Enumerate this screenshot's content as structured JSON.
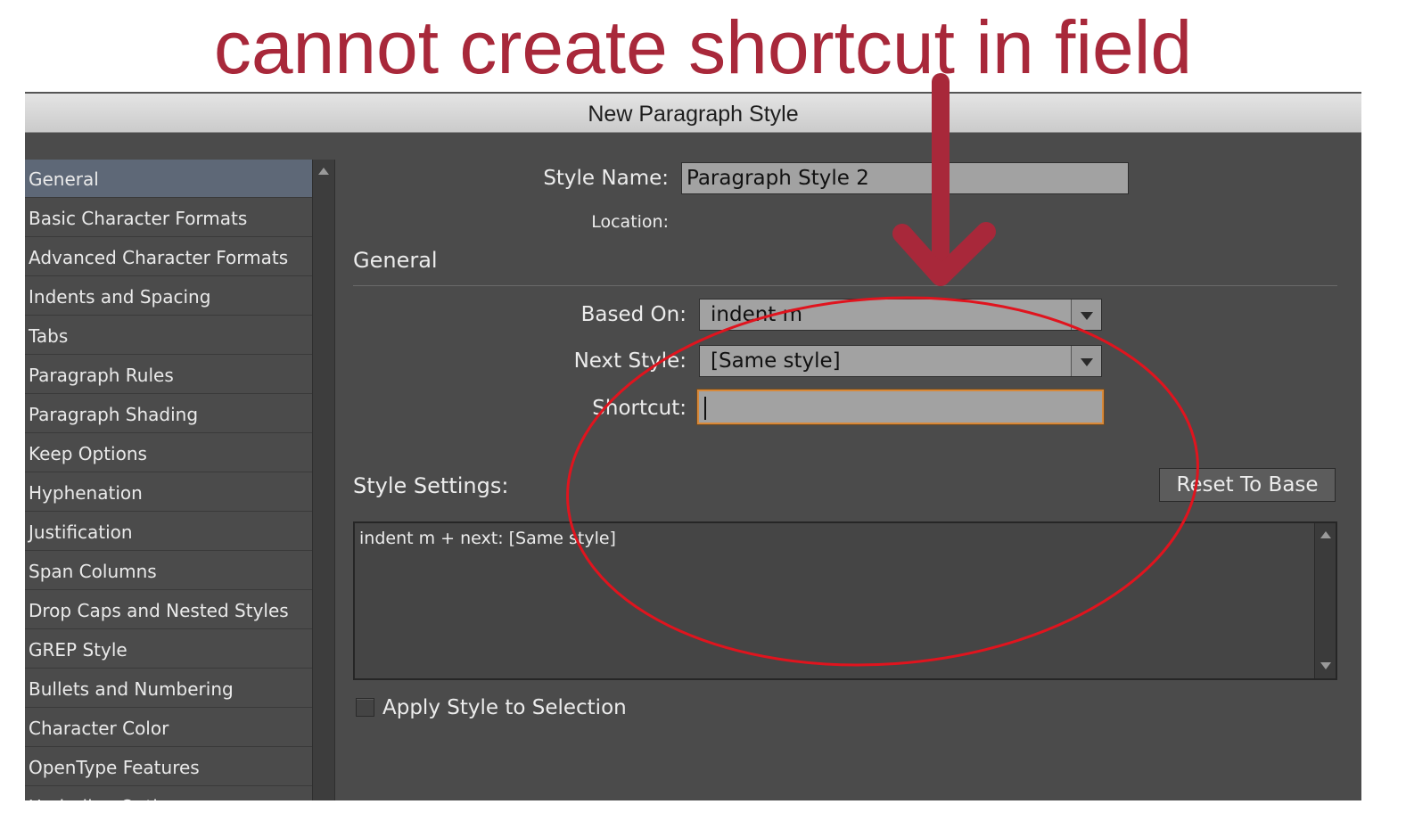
{
  "annotation": {
    "title": "cannot create shortcut in field",
    "color": "#a8283a",
    "circle_color": "#e0141e"
  },
  "window": {
    "title": "New Paragraph Style"
  },
  "sidebar": {
    "items": [
      {
        "label": "General",
        "selected": true
      },
      {
        "label": "Basic Character Formats"
      },
      {
        "label": "Advanced Character Formats"
      },
      {
        "label": "Indents and Spacing"
      },
      {
        "label": "Tabs"
      },
      {
        "label": "Paragraph Rules"
      },
      {
        "label": "Paragraph Shading"
      },
      {
        "label": "Keep Options"
      },
      {
        "label": "Hyphenation"
      },
      {
        "label": "Justification"
      },
      {
        "label": "Span Columns"
      },
      {
        "label": "Drop Caps and Nested Styles"
      },
      {
        "label": "GREP Style"
      },
      {
        "label": "Bullets and Numbering"
      },
      {
        "label": "Character Color"
      },
      {
        "label": "OpenType Features"
      },
      {
        "label": "Underline Options"
      }
    ]
  },
  "form": {
    "style_name_label": "Style Name:",
    "style_name_value": "Paragraph Style 2",
    "location_label": "Location:",
    "section_heading": "General",
    "based_on_label": "Based On:",
    "based_on_value": "indent m",
    "next_style_label": "Next Style:",
    "next_style_value": "[Same style]",
    "shortcut_label": "Shortcut:",
    "shortcut_value": "",
    "style_settings_label": "Style Settings:",
    "reset_button_label": "Reset To Base",
    "style_settings_text": "indent m + next: [Same style]",
    "apply_checkbox_label": "Apply Style to Selection",
    "apply_checked": false
  }
}
